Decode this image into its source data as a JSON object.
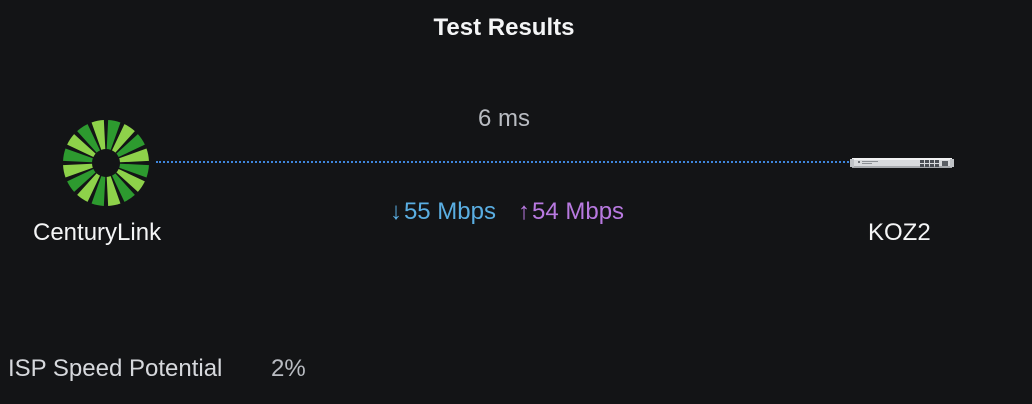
{
  "title": "Test Results",
  "latency": "6 ms",
  "isp": {
    "name": "CenturyLink",
    "logo_icon": "centurylink-logo-icon",
    "logo_colors": [
      "#2d9a2f",
      "#8ed24a"
    ]
  },
  "device": {
    "name": "KOZ2",
    "icon": "network-switch-icon"
  },
  "speeds": {
    "download": {
      "arrow": "↓",
      "value": "55 Mbps",
      "color": "#5aaee2"
    },
    "upload": {
      "arrow": "↑",
      "value": "54 Mbps",
      "color": "#b879e0"
    }
  },
  "link_line_color": "#3e86dd",
  "isp_speed_potential": {
    "label": "ISP Speed Potential",
    "value": "2%"
  }
}
